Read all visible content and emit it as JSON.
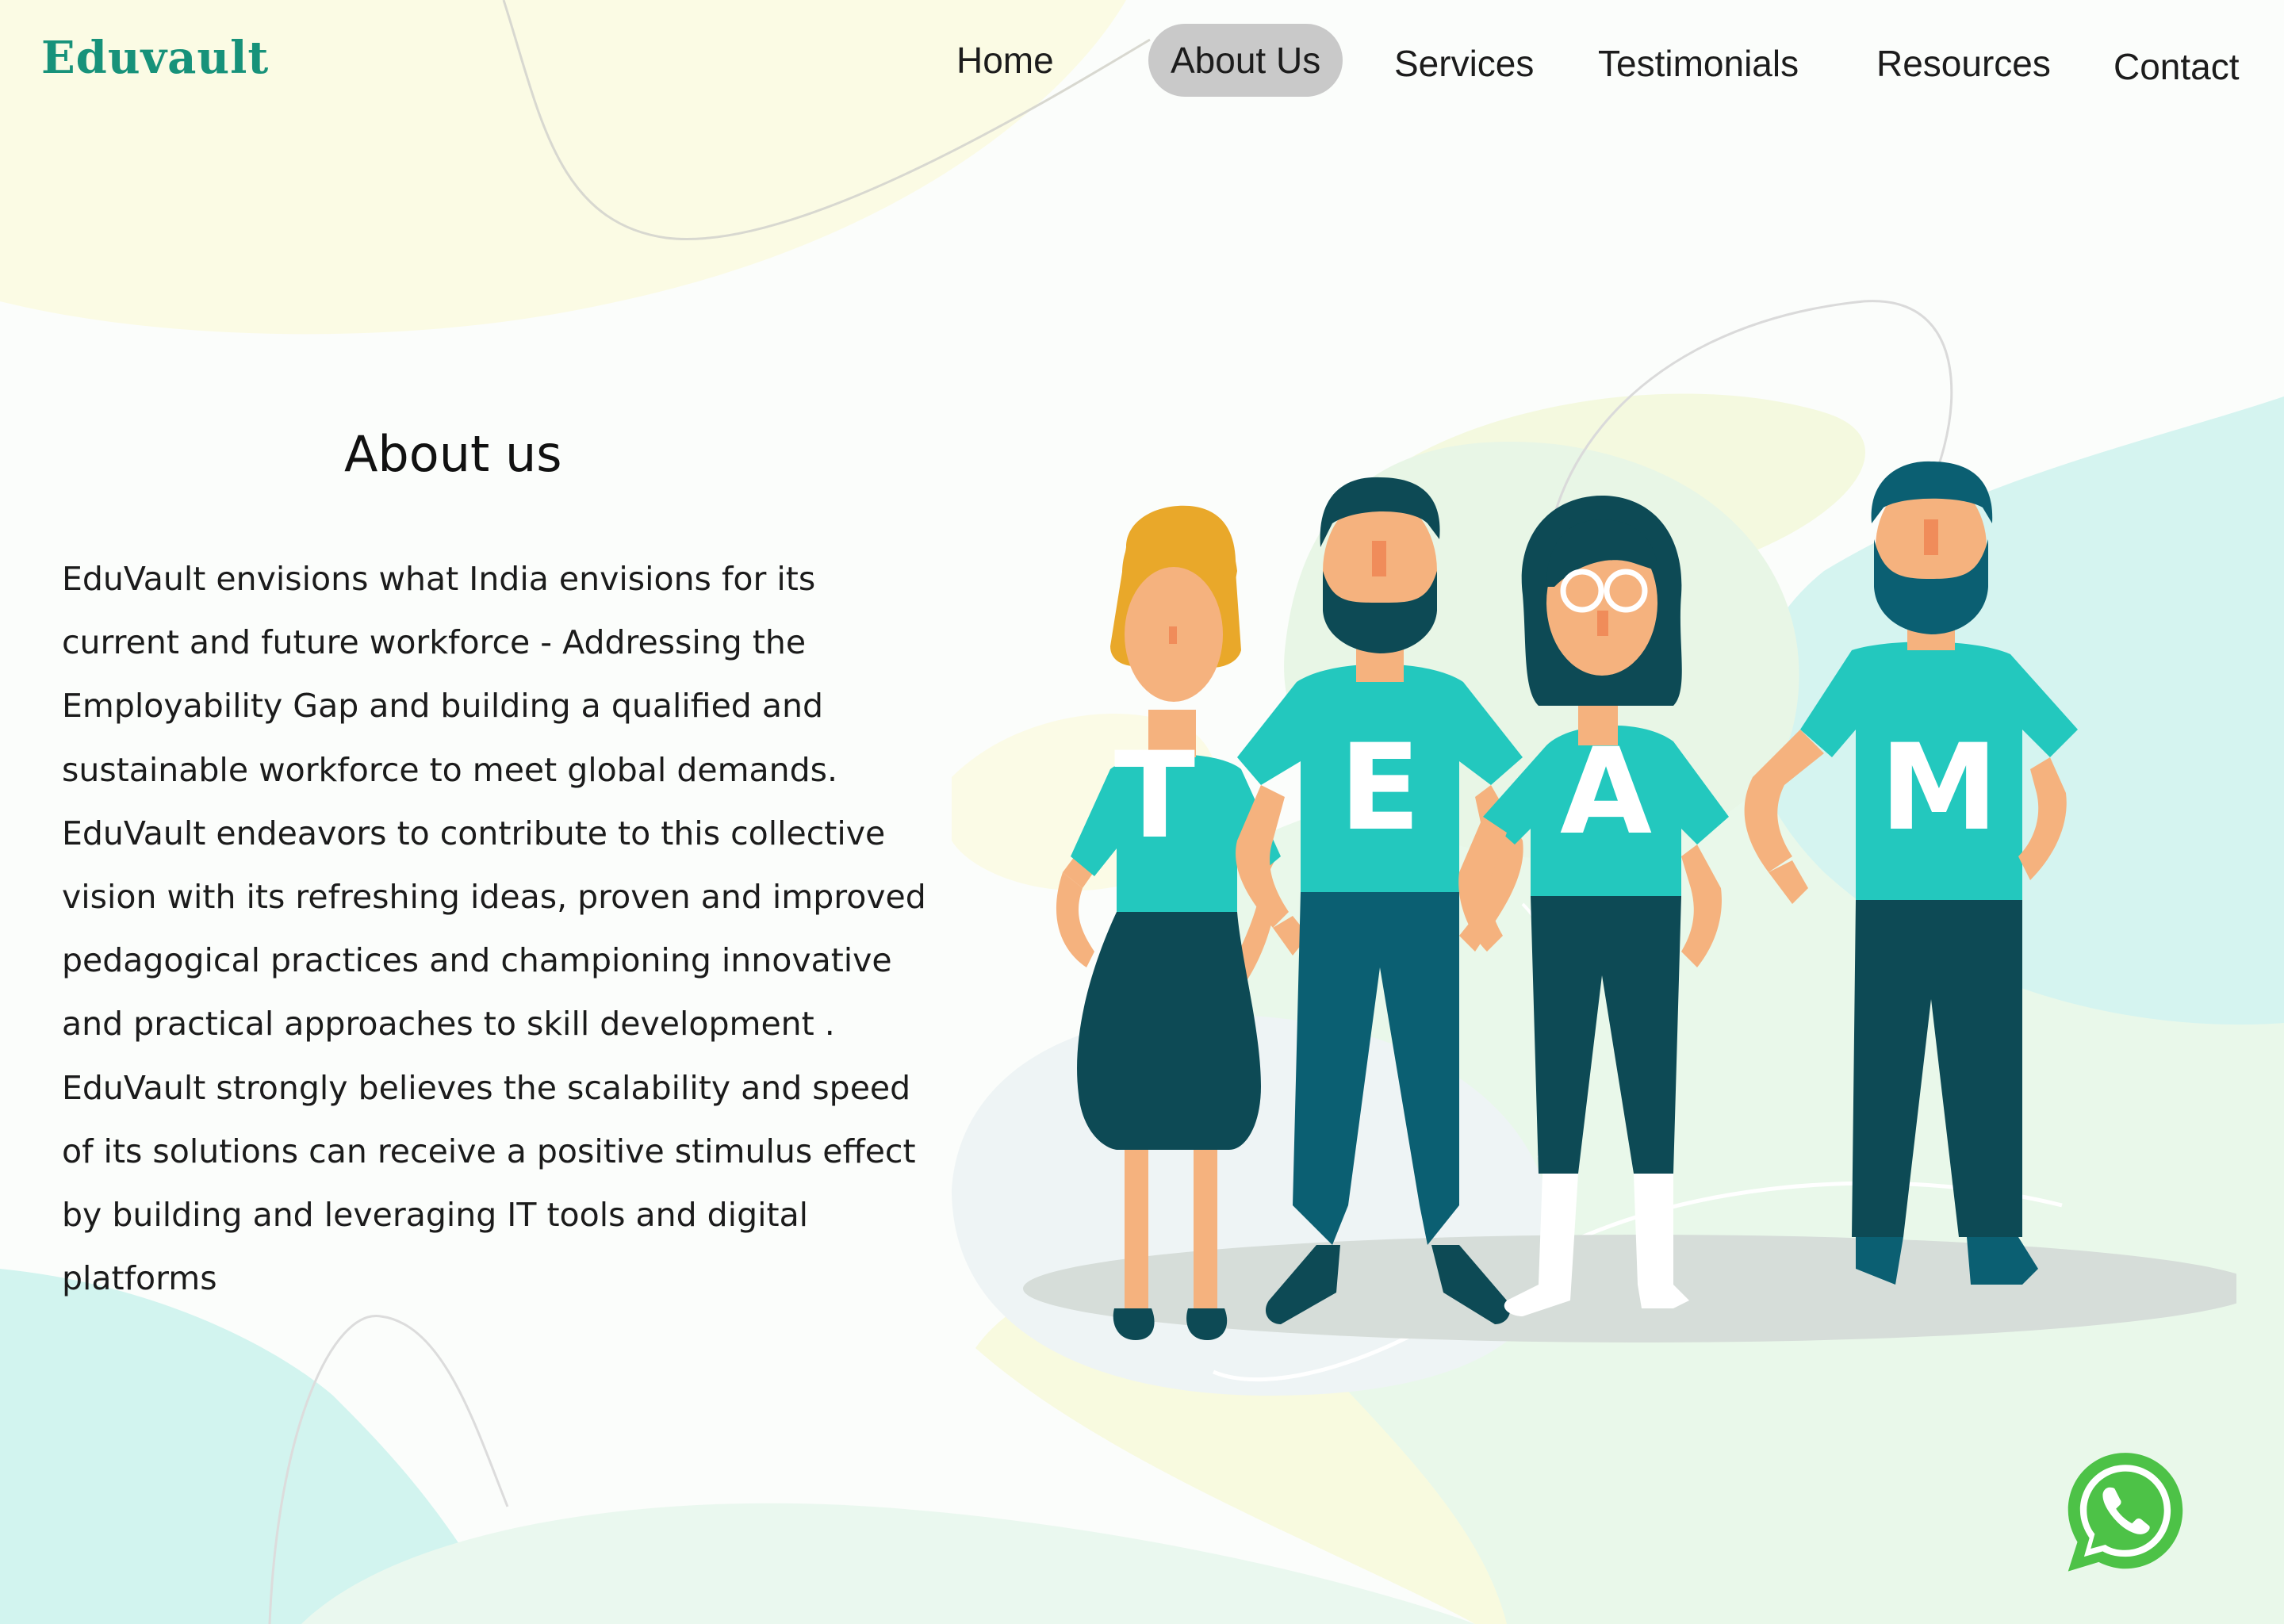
{
  "brand": {
    "name": "Eduvault",
    "color": "#17927a"
  },
  "nav": {
    "items": [
      {
        "label": "Home"
      },
      {
        "label": "About Us",
        "active": true
      },
      {
        "label": "Services"
      },
      {
        "label": "Testimonials"
      },
      {
        "label": "Resources"
      },
      {
        "label": "Contact"
      }
    ]
  },
  "about": {
    "title": "About us",
    "body": "EduVault envisions what India envisions for its current and future workforce - Addressing the Employability Gap and building a qualified and sustainable workforce to meet global demands. EduVault endeavors to contribute to this collective vision with its refreshing ideas, proven and improved pedagogical practices and championing innovative and practical approaches to skill development . EduVault strongly believes the scalability and speed of its solutions can receive a positive stimulus effect by building and leveraging IT tools and digital platforms"
  },
  "illustration": {
    "letters": [
      "T",
      "E",
      "A",
      "M"
    ],
    "colors": {
      "shirt": "#23c8be",
      "dark": "#0d4a55",
      "skin": "#f5b27e",
      "hair_blonde": "#e9a82a"
    }
  },
  "whatsapp": {
    "icon": "whatsapp-icon",
    "color": "#4dc247"
  }
}
